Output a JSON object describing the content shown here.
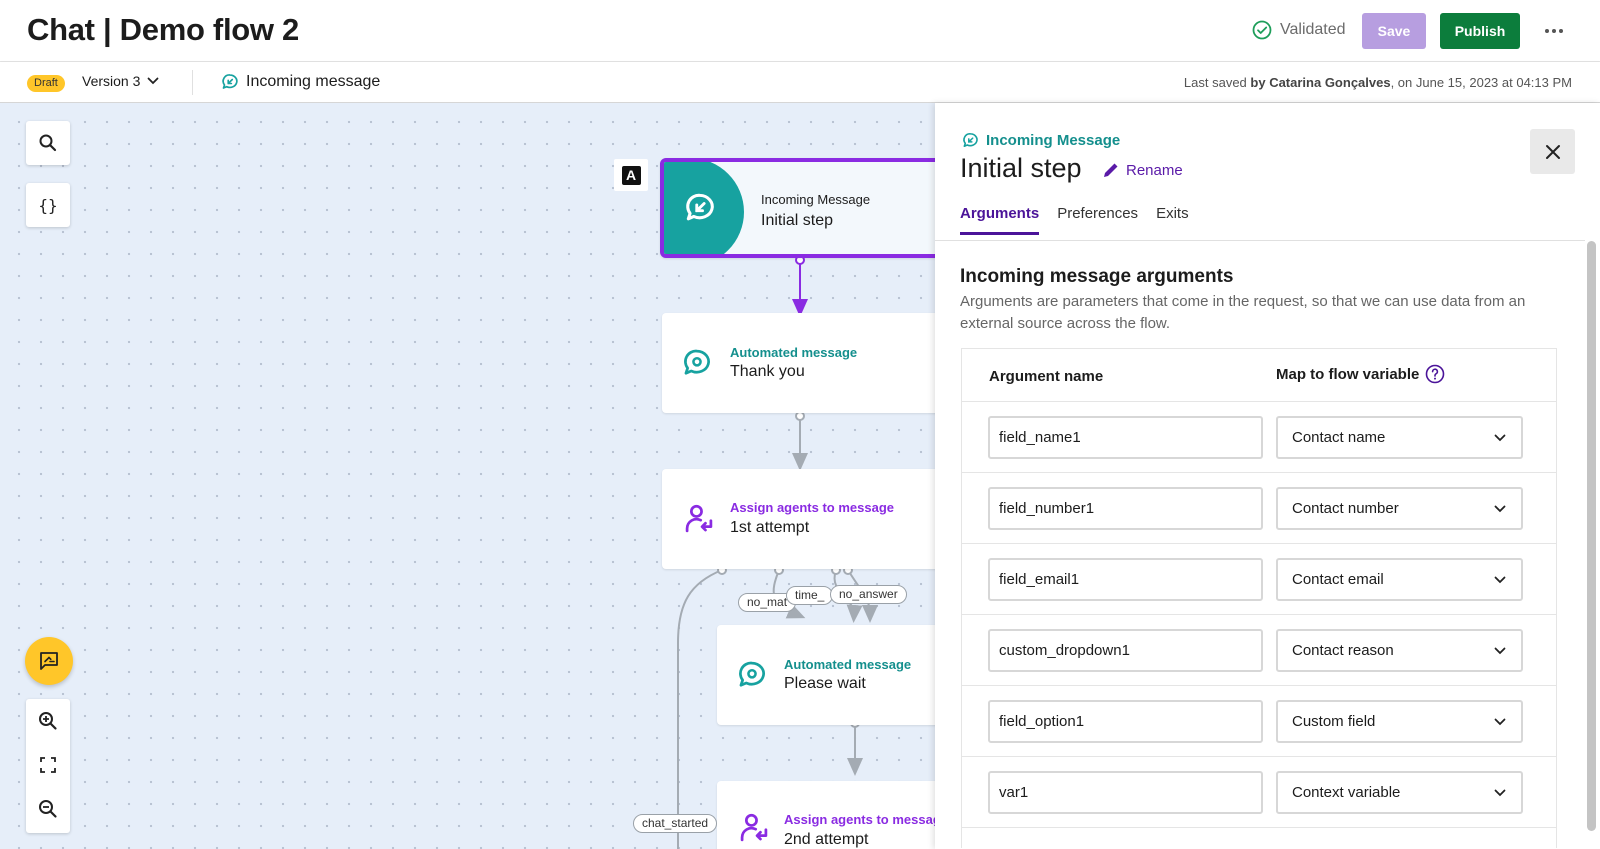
{
  "header": {
    "title": "Chat | Demo flow 2",
    "validated_label": "Validated",
    "save_label": "Save",
    "publish_label": "Publish"
  },
  "subheader": {
    "draft_badge": "Draft",
    "version_label": "Version 3",
    "current_step": "Incoming message",
    "last_saved_prefix": "Last saved ",
    "last_saved_by": "by Catarina Gonçalves",
    "last_saved_suffix": ", on June 15, 2023 at 04:13 PM"
  },
  "canvas": {
    "tools": {
      "variables_label": "{}"
    },
    "start_badge": "A",
    "nodes": [
      {
        "type": "Incoming Message",
        "name": "Initial step"
      },
      {
        "type": "Automated message",
        "name": "Thank you"
      },
      {
        "type": "Assign agents to message",
        "name": "1st attempt"
      },
      {
        "type": "Automated message",
        "name": "Please wait"
      },
      {
        "type": "Assign agents to messag",
        "name": "2nd attempt"
      }
    ],
    "connector_labels": [
      "no_mat",
      "time_",
      "no_answer",
      "chat_started"
    ]
  },
  "panel": {
    "eyebrow": "Incoming Message",
    "title": "Initial step",
    "rename_label": "Rename",
    "tabs": [
      {
        "label": "Arguments",
        "active": true
      },
      {
        "label": "Preferences",
        "active": false
      },
      {
        "label": "Exits",
        "active": false
      }
    ],
    "section_title": "Incoming message arguments",
    "section_desc": "Arguments are parameters that come in the request, so that we can use data from an external source across the flow.",
    "table": {
      "col_argument": "Argument name",
      "col_map": "Map to flow variable",
      "rows": [
        {
          "argument": "field_name1",
          "variable": "Contact name"
        },
        {
          "argument": "field_number1",
          "variable": "Contact number"
        },
        {
          "argument": "field_email1",
          "variable": "Contact email"
        },
        {
          "argument": "custom_dropdown1",
          "variable": "Contact reason"
        },
        {
          "argument": "field_option1",
          "variable": "Custom field"
        },
        {
          "argument": "var1",
          "variable": "Context variable"
        }
      ]
    }
  },
  "colors": {
    "teal": "#17a2a0",
    "purple": "#8a2be2",
    "publish_green": "#0c7d3c",
    "save_lilac": "#b79ee0",
    "draft_yellow": "#ffc629"
  }
}
